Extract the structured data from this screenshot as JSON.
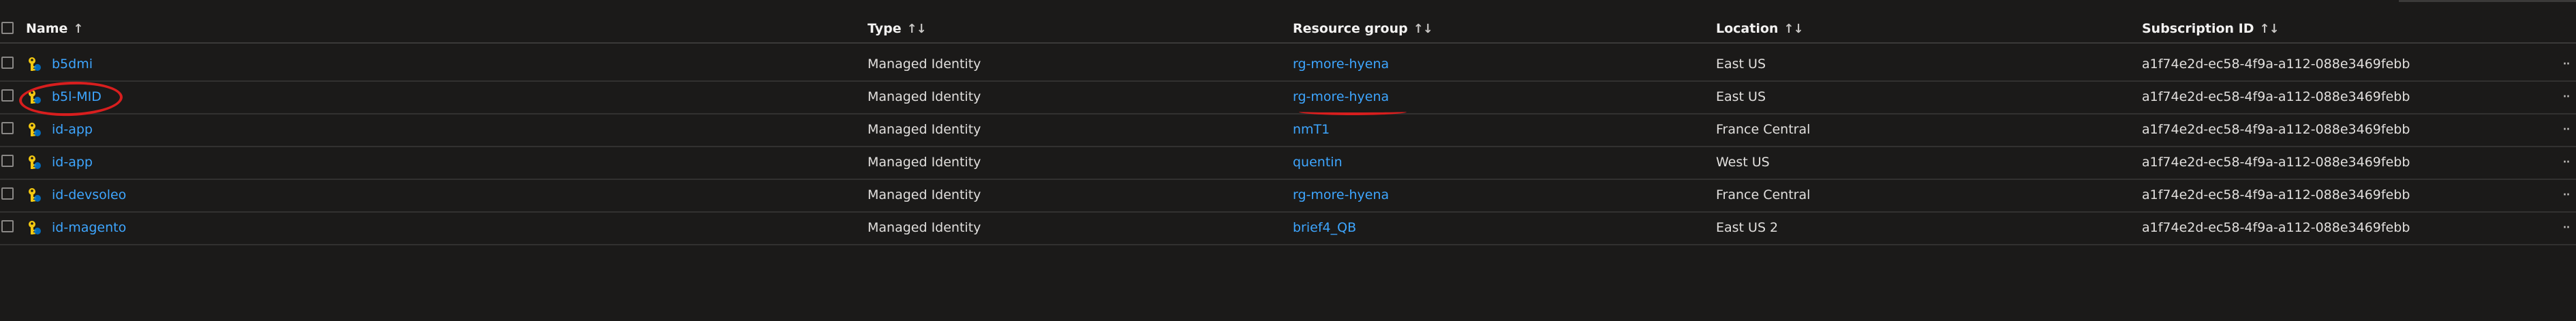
{
  "columns": {
    "name": "Name",
    "type": "Type",
    "resource_group": "Resource group",
    "location": "Location",
    "subscription_id": "Subscription ID"
  },
  "rows": [
    {
      "name": "b5dmi",
      "type": "Managed Identity",
      "resource_group": "rg-more-hyena",
      "location": "East US",
      "subscription_id": "a1f74e2d-ec58-4f9a-a112-088e3469febb"
    },
    {
      "name": "b5l-MID",
      "type": "Managed Identity",
      "resource_group": "rg-more-hyena",
      "location": "East US",
      "subscription_id": "a1f74e2d-ec58-4f9a-a112-088e3469febb"
    },
    {
      "name": "id-app",
      "type": "Managed Identity",
      "resource_group": "nmT1",
      "location": "France Central",
      "subscription_id": "a1f74e2d-ec58-4f9a-a112-088e3469febb"
    },
    {
      "name": "id-app",
      "type": "Managed Identity",
      "resource_group": "quentin",
      "location": "West US",
      "subscription_id": "a1f74e2d-ec58-4f9a-a112-088e3469febb"
    },
    {
      "name": "id-devsoleo",
      "type": "Managed Identity",
      "resource_group": "rg-more-hyena",
      "location": "France Central",
      "subscription_id": "a1f74e2d-ec58-4f9a-a112-088e3469febb"
    },
    {
      "name": "id-magento",
      "type": "Managed Identity",
      "resource_group": "brief4_QB",
      "location": "East US 2",
      "subscription_id": "a1f74e2d-ec58-4f9a-a112-088e3469febb"
    }
  ],
  "icons": {
    "row_icon": "managed-identity-icon",
    "sort": "sort-arrows-icon",
    "more": "more-actions-icon"
  },
  "colors": {
    "link": "#3ea6ff",
    "annotation": "#d81e1e",
    "identity_icon": "#f2c811"
  }
}
